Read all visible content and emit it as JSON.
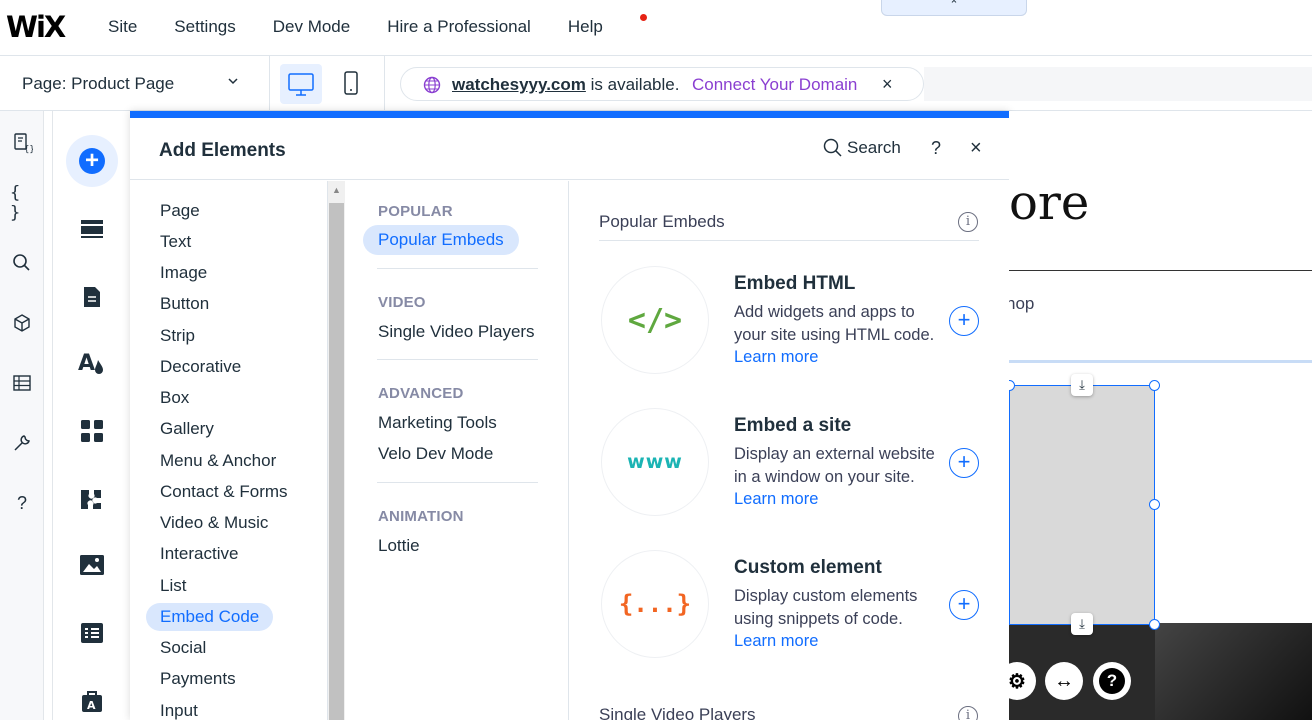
{
  "topbar": {
    "logo": "WiX",
    "nav": [
      "Site",
      "Settings",
      "Dev Mode",
      "Hire a Professional",
      "Help"
    ],
    "collapse_glyph": "⌃"
  },
  "secondbar": {
    "page_prefix": "Page:",
    "page_name": "Product Page",
    "domain_name": "watchesyyy.com",
    "domain_status": "is available.",
    "connect_label": "Connect Your Domain",
    "close_glyph": "×"
  },
  "panel": {
    "title": "Add Elements",
    "search_label": "Search",
    "help_glyph": "?",
    "close_glyph": "×",
    "categories": [
      "Page",
      "Text",
      "Image",
      "Button",
      "Strip",
      "Decorative",
      "Box",
      "Gallery",
      "Menu & Anchor",
      "Contact & Forms",
      "Video & Music",
      "Interactive",
      "List",
      "Embed Code",
      "Social",
      "Payments",
      "Input"
    ],
    "selected_category": "Embed Code",
    "subsections": [
      {
        "label": "POPULAR",
        "items": [
          "Popular Embeds"
        ]
      },
      {
        "label": "VIDEO",
        "items": [
          "Single Video Players"
        ]
      },
      {
        "label": "ADVANCED",
        "items": [
          "Marketing Tools",
          "Velo Dev Mode"
        ]
      },
      {
        "label": "ANIMATION",
        "items": [
          "Lottie"
        ]
      }
    ],
    "selected_subsection": "Popular Embeds",
    "content": {
      "section_title": "Popular Embeds",
      "next_section_title": "Single Video Players",
      "items": [
        {
          "title": "Embed HTML",
          "desc": "Add widgets and apps to your site using HTML code.",
          "link": "Learn more",
          "thumb_text": "</>",
          "thumb_color": "#5fa83f"
        },
        {
          "title": "Embed a site",
          "desc": "Display an external website in a window on your site.",
          "link": "Learn more",
          "thumb_text": "www",
          "thumb_color": "#1bb4b4"
        },
        {
          "title": "Custom element",
          "desc": "Display custom elements using snippets of code.",
          "link": "Learn more",
          "thumb_text": "{...}",
          "thumb_color": "#f26522"
        }
      ]
    }
  },
  "canvas": {
    "heading_fragment": "ore",
    "shop_fragment": "hop"
  },
  "colors": {
    "accent": "#116dff",
    "purple": "#8a3fd1",
    "help_dot": "#e62214"
  }
}
